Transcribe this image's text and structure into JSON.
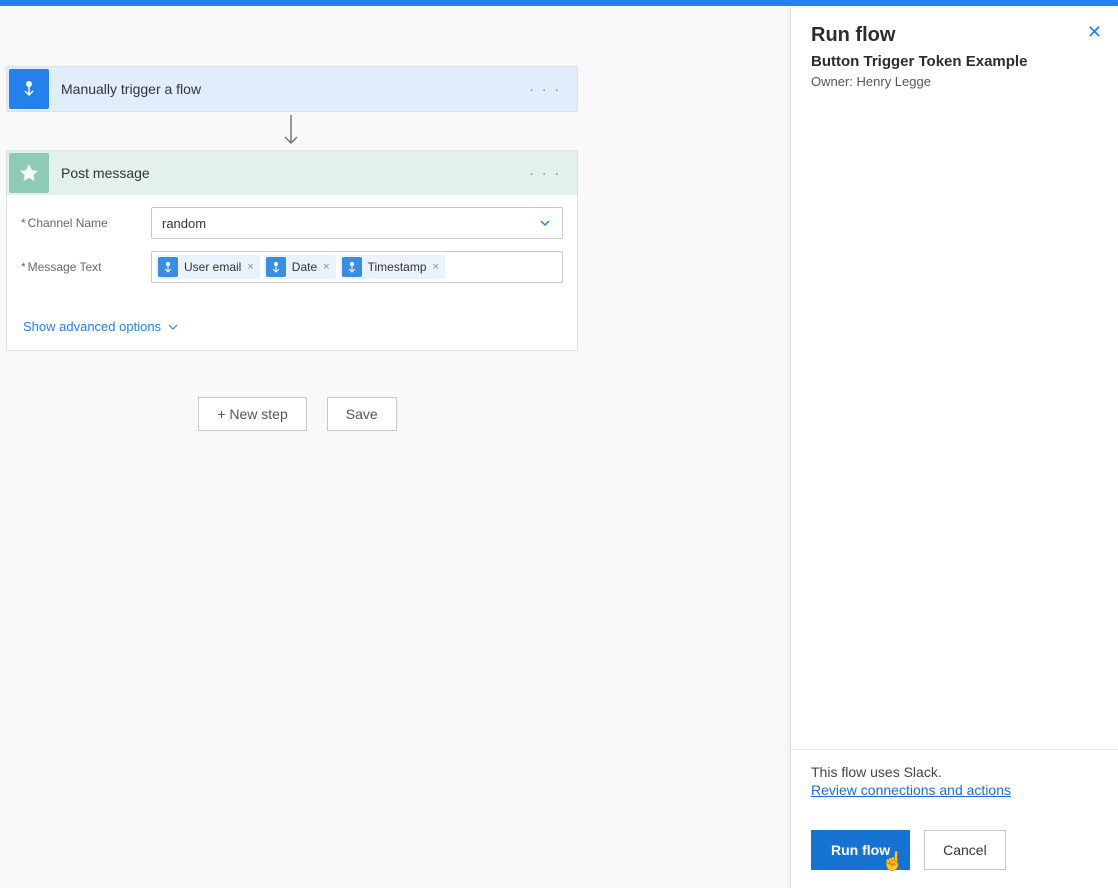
{
  "trigger": {
    "title": "Manually trigger a flow"
  },
  "action": {
    "title": "Post message",
    "channel_label": "Channel Name",
    "channel_value": "random",
    "message_label": "Message Text",
    "tokens": [
      "User email",
      "Date",
      "Timestamp"
    ],
    "advanced": "Show advanced options"
  },
  "buttons": {
    "new_step": "+ New step",
    "save": "Save"
  },
  "panel": {
    "title": "Run flow",
    "subtitle": "Button Trigger Token Example",
    "owner": "Owner: Henry Legge",
    "uses": "This flow uses Slack.",
    "review": "Review connections and actions",
    "run": "Run flow",
    "cancel": "Cancel"
  }
}
